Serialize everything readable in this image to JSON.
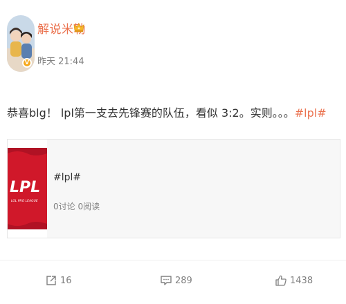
{
  "author": {
    "name": "解说米勒",
    "verified_badge": "V",
    "timestamp": "昨天 21:44",
    "icons": [
      "avatar",
      "crown-icon",
      "verified-icon"
    ]
  },
  "post": {
    "text": "恭喜blg！ lpl第一支去先锋赛的队伍，看似 3:2。实则。。。",
    "hashtag": "#lpl#"
  },
  "card": {
    "logo_text": "LPL",
    "logo_subtext": "LOL PRO LEAGUE",
    "title": "#lpl#",
    "meta": "0讨论 0阅读"
  },
  "actions": {
    "repost_count": "16",
    "comment_count": "289",
    "like_count": "1438",
    "icons": [
      "repost-icon",
      "comment-icon",
      "like-icon"
    ]
  },
  "colors": {
    "accent": "#eb7350",
    "badge": "#f6a81c",
    "lpl_red": "#d0182a",
    "muted": "#808080"
  }
}
